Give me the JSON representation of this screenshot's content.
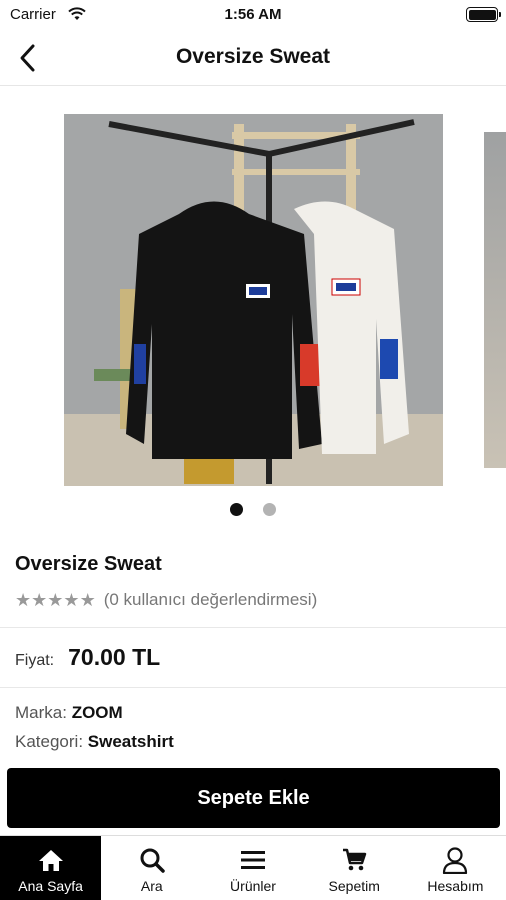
{
  "status_bar": {
    "carrier": "Carrier",
    "time": "1:56 AM",
    "icons": [
      "wifi-icon",
      "battery-icon"
    ]
  },
  "nav": {
    "title": "Oversize Sweat",
    "back_icon": "chevron-left-icon"
  },
  "carousel": {
    "image_alt": "Oversize hoodies on rack",
    "page_count": 2,
    "active_index": 0
  },
  "product": {
    "title": "Oversize Sweat",
    "stars_filled": 5,
    "rating_text": "(0 kullanıcı değerlendirmesi)",
    "price_label": "Fiyat:",
    "price_value": "70.00 TL",
    "brand_label": "Marka:",
    "brand_value": "ZOOM",
    "category_label": "Kategori:",
    "category_value": "Sweatshirt"
  },
  "add_to_cart": {
    "label": "Sepete Ekle"
  },
  "tabs": [
    {
      "label": "Ana Sayfa",
      "icon": "home-icon",
      "active": true
    },
    {
      "label": "Ara",
      "icon": "search-icon",
      "active": false
    },
    {
      "label": "Ürünler",
      "icon": "menu-icon",
      "active": false
    },
    {
      "label": "Sepetim",
      "icon": "cart-icon",
      "active": false
    },
    {
      "label": "Hesabım",
      "icon": "user-icon",
      "active": false
    }
  ],
  "colors": {
    "primary": "#000000",
    "background": "#ffffff",
    "star": "#999999",
    "muted_text": "#777777"
  }
}
